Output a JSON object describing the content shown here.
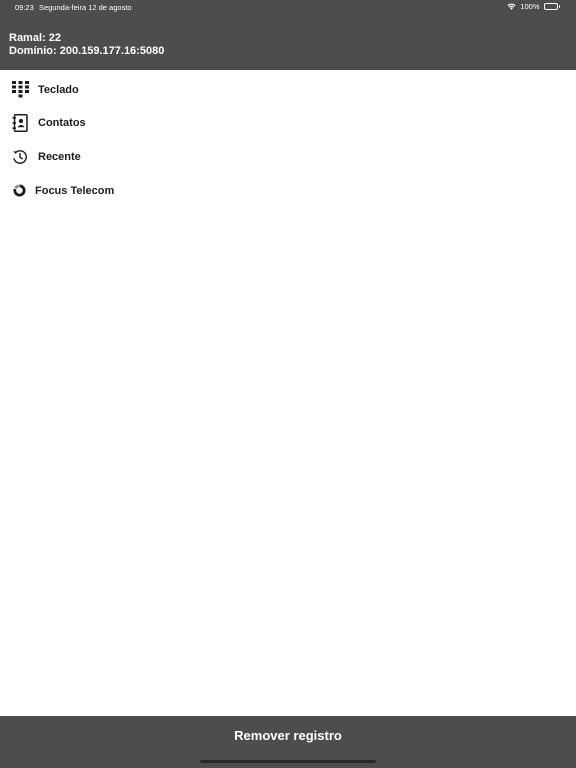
{
  "status_bar": {
    "time": "09:23",
    "date": "Segunda-feira 12 de agosto",
    "battery": "100%"
  },
  "account": {
    "ramal": "Ramal: 22",
    "dominio": "Domínio: 200.159.177.16:5080"
  },
  "menu": {
    "items": [
      {
        "label": "Teclado",
        "icon": "keypad-icon"
      },
      {
        "label": "Contatos",
        "icon": "contacts-book-icon"
      },
      {
        "label": "Recente",
        "icon": "history-clock-icon"
      },
      {
        "label": "Focus Telecom",
        "icon": "focus-telecom-logo-icon"
      }
    ]
  },
  "footer": {
    "remove_label": "Remover registro"
  },
  "colors": {
    "header_bg": "#4d4d4d",
    "footer_bg": "#4d4d4d",
    "text": "#1c1c1e",
    "background": "#ffffff"
  }
}
